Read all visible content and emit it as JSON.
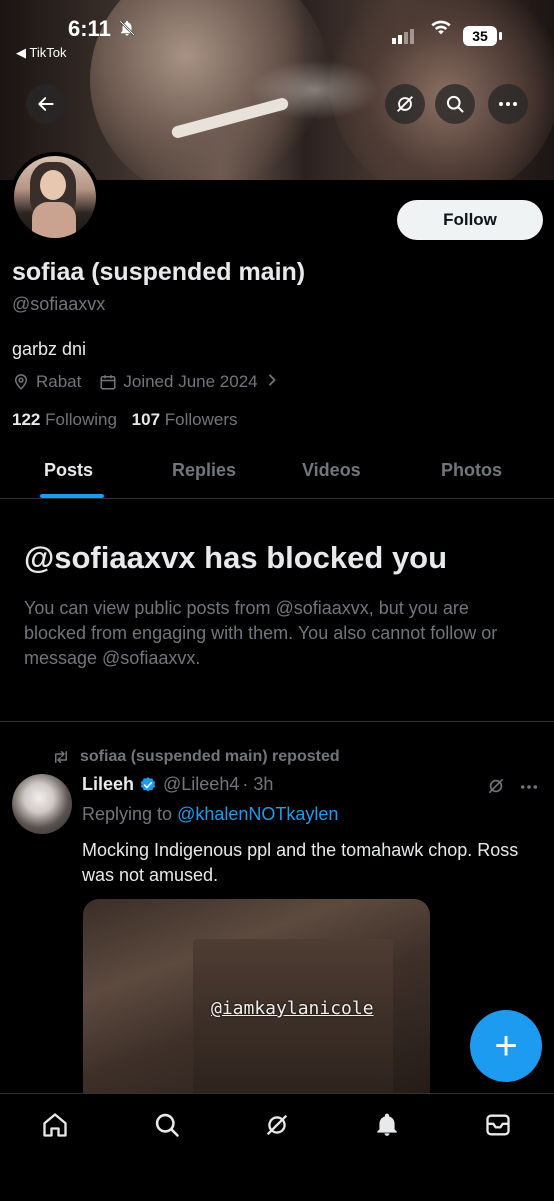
{
  "status_bar": {
    "time": "6:11",
    "back_app_label": "◀ TikTok",
    "battery": "35"
  },
  "header_buttons": {
    "back": "back-arrow-icon",
    "grok": "grok-icon",
    "search": "search-icon",
    "more": "more-icon"
  },
  "profile": {
    "follow_label": "Follow",
    "display_name": "sofiaa (suspended main)",
    "handle": "@sofiaaxvx",
    "bio": "garbz dni",
    "location": "Rabat",
    "joined": "Joined June 2024",
    "following_count": "122",
    "following_label": "Following",
    "followers_count": "107",
    "followers_label": "Followers"
  },
  "tabs": [
    "Posts",
    "Replies",
    "Videos",
    "Photos"
  ],
  "blocked": {
    "title": "@sofiaaxvx has blocked you",
    "text": "You can view public posts from @sofiaaxvx, but you are blocked from engaging with them. You also cannot follow or message @sofiaaxvx."
  },
  "post": {
    "repost_label": "sofiaa (suspended main) reposted",
    "author_name": "Lileeh",
    "author_handle": "@Lileeh4",
    "time": "· 3h",
    "replying_prefix": "Replying to ",
    "replying_to": "@khalenNOTkaylen",
    "text": "Mocking Indigenous ppl and the tomahawk chop. Ross was not amused.",
    "media_watermark": "@iamkaylanicole"
  },
  "fab_label": "+",
  "colors": {
    "accent": "#1d9bf0",
    "background": "#000000",
    "secondary_text": "#71767b",
    "primary_text": "#e7e9ea"
  }
}
